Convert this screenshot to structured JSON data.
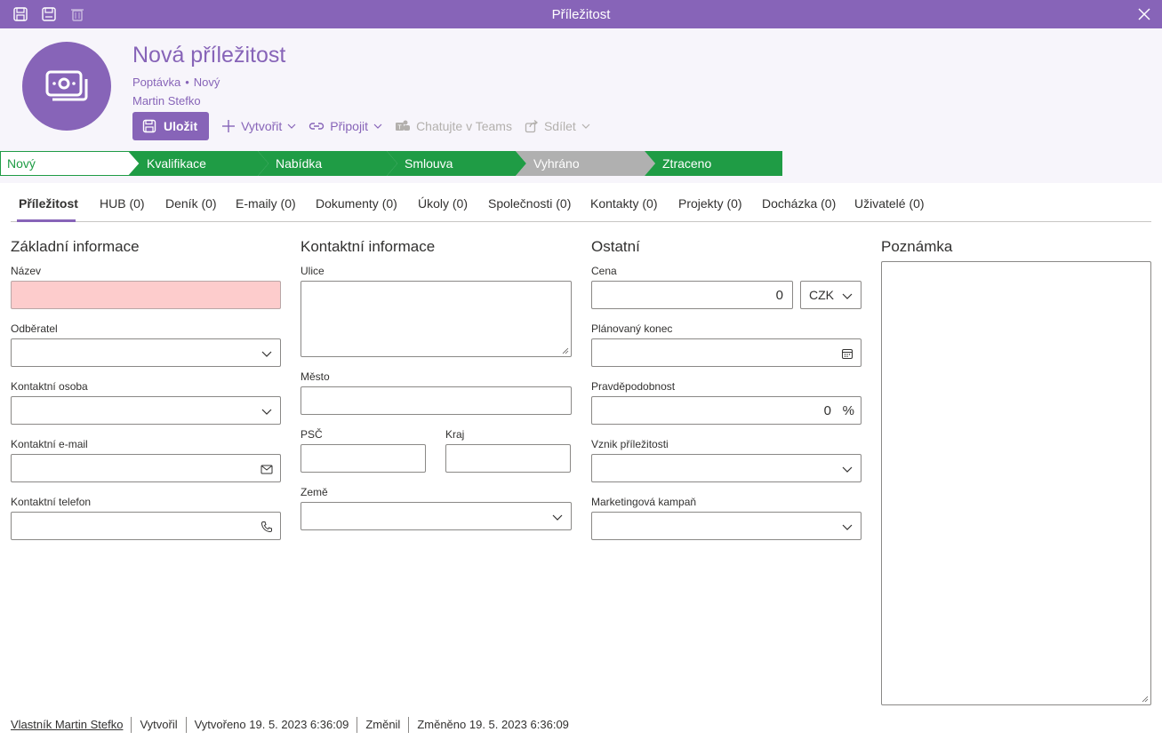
{
  "window": {
    "title": "Příležitost"
  },
  "record": {
    "title": "Nová příležitost",
    "type": "Poptávka",
    "status": "Nový",
    "owner": "Martin Stefko"
  },
  "toolbar": {
    "save": "Uložit",
    "create": "Vytvořit",
    "attach": "Připojit",
    "teams": "Chatujte v Teams",
    "share": "Sdílet"
  },
  "process": {
    "stages": [
      "Nový",
      "Kvalifikace",
      "Nabídka",
      "Smlouva",
      "Vyhráno",
      "Ztraceno"
    ],
    "colors": {
      "active": "#1f9c45",
      "inactive": "#b0b0b0",
      "outline": "#1f9c45"
    }
  },
  "tabs": [
    "Příležitost",
    "HUB (0)",
    "Deník (0)",
    "E-maily (0)",
    "Dokumenty (0)",
    "Úkoly (0)",
    "Společnosti (0)",
    "Kontakty (0)",
    "Projekty (0)",
    "Docházka (0)",
    "Uživatelé (0)"
  ],
  "basic": {
    "title": "Základní informace",
    "name_label": "Název",
    "customer_label": "Odběratel",
    "contact_label": "Kontaktní osoba",
    "email_label": "Kontaktní e-mail",
    "phone_label": "Kontaktní telefon"
  },
  "contact": {
    "title": "Kontaktní informace",
    "street_label": "Ulice",
    "city_label": "Město",
    "zip_label": "PSČ",
    "region_label": "Kraj",
    "country_label": "Země"
  },
  "other": {
    "title": "Ostatní",
    "price_label": "Cena",
    "price_value": "0",
    "currency": "CZK",
    "end_label": "Plánovaný konec",
    "probability_label": "Pravděpodobnost",
    "probability_value": "0",
    "probability_unit": "%",
    "origin_label": "Vznik příležitosti",
    "campaign_label": "Marketingová kampaň"
  },
  "note": {
    "title": "Poznámka"
  },
  "footer": {
    "owner": "Vlastník Martin Stefko",
    "created_by": "Vytvořil",
    "created": "Vytvořeno 19. 5. 2023 6:36:09",
    "modified_by": "Změnil",
    "modified": "Změněno 19. 5. 2023 6:36:09"
  },
  "colors": {
    "accent": "#8764b8",
    "error_field": "#fdcccc"
  }
}
